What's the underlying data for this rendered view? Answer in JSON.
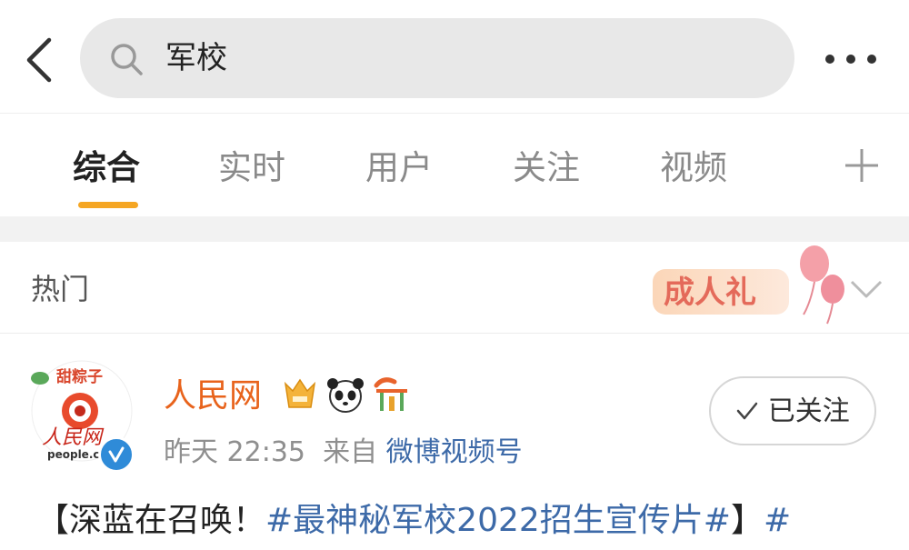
{
  "search": {
    "query": "军校"
  },
  "tabs": [
    {
      "label": "综合"
    },
    {
      "label": "实时"
    },
    {
      "label": "用户"
    },
    {
      "label": "关注"
    },
    {
      "label": "视频"
    }
  ],
  "hot": {
    "label": "热门",
    "banner_text": "成人礼"
  },
  "post": {
    "avatar_top_text": "甜粽子",
    "avatar_logo_text": "人民网",
    "avatar_domain_text": "people.c",
    "author": "人民网",
    "time": "昨天 22:35",
    "source_prefix": "来自",
    "source": "微博视频号",
    "follow_label": "已关注",
    "text_prefix": "【深蓝在召唤！",
    "hashtag": "#最神秘军校2022招生宣传片#",
    "text_suffix": "】",
    "trailing_hash": "#"
  },
  "colors": {
    "accent": "#f5a623",
    "link": "#3d6aa8",
    "author": "#e8631c",
    "verified": "#2f8bd8"
  }
}
